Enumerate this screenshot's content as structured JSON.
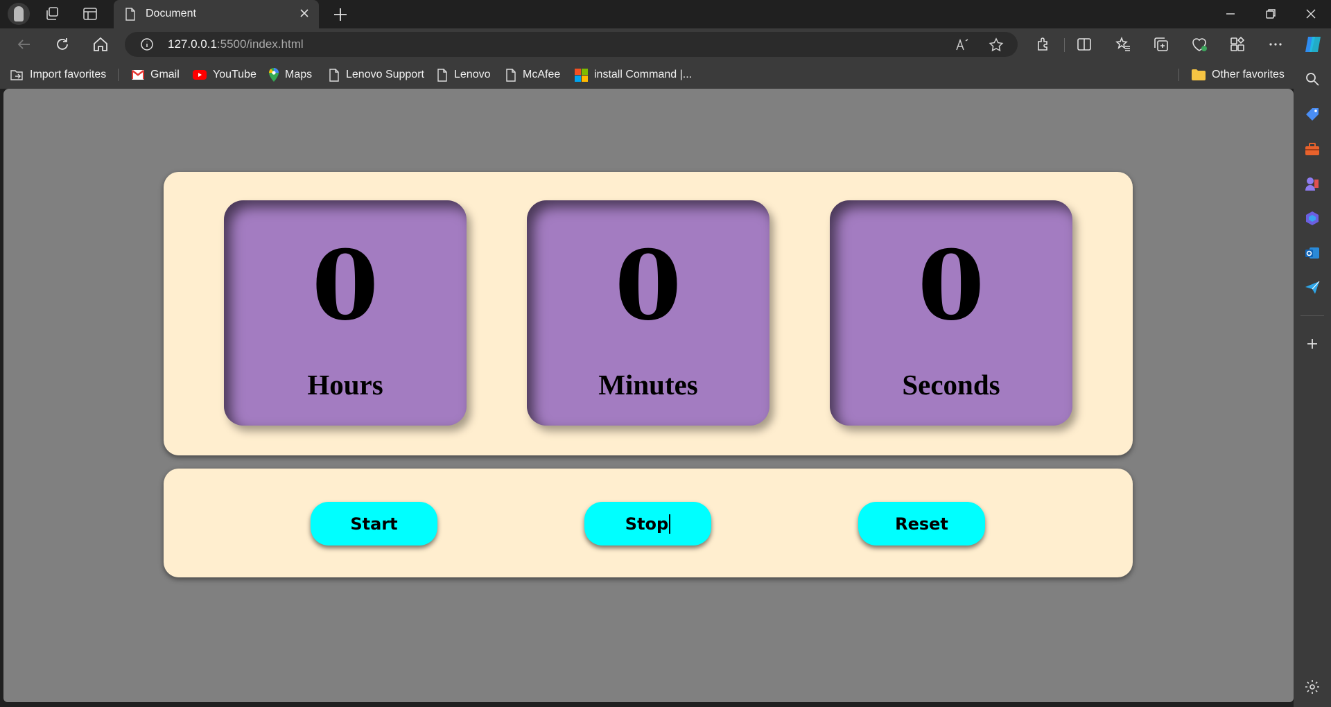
{
  "browser": {
    "tab_title": "Document",
    "url_host": "127.0.0.1",
    "url_path": ":5500/index.html"
  },
  "bookmarks": {
    "items": [
      {
        "label": "Import favorites",
        "icon": "import-icon"
      },
      {
        "label": "Gmail",
        "icon": "gmail-icon"
      },
      {
        "label": "YouTube",
        "icon": "youtube-icon"
      },
      {
        "label": "Maps",
        "icon": "maps-icon"
      },
      {
        "label": "Lenovo Support",
        "icon": "page-icon"
      },
      {
        "label": "Lenovo",
        "icon": "page-icon"
      },
      {
        "label": "McAfee",
        "icon": "page-icon"
      },
      {
        "label": "install Command |...",
        "icon": "microsoft-icon"
      }
    ],
    "other_favorites": "Other favorites"
  },
  "timer": {
    "hours": {
      "value": "0",
      "label": "Hours"
    },
    "minutes": {
      "value": "0",
      "label": "Minutes"
    },
    "seconds": {
      "value": "0",
      "label": "Seconds"
    }
  },
  "controls": {
    "start_label": "Start",
    "stop_label": "Stop",
    "reset_label": "Reset"
  },
  "colors": {
    "page_background": "#808080",
    "panel": "#ffeecf",
    "card": "#a37cc1",
    "button": "#00ffff"
  }
}
